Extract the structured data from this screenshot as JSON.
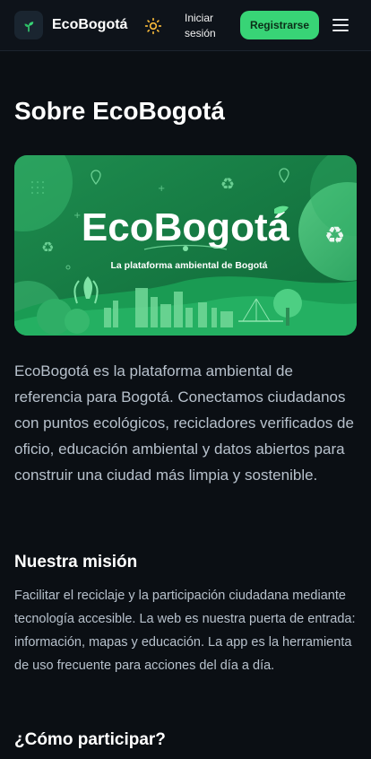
{
  "nav": {
    "brand": "EcoBogotá",
    "login_label": "Iniciar sesión",
    "register_label": "Registrarse",
    "logo_icon": "sprout-icon",
    "theme_icon": "sun-icon",
    "menu_icon": "hamburger-icon"
  },
  "page": {
    "title": "Sobre EcoBogotá"
  },
  "hero": {
    "heading": "EcoBogotá",
    "tagline": "La plataforma ambiental de Bogotá"
  },
  "intro": "EcoBogotá es la plataforma ambiental de referencia para Bogotá. Conectamos ciudadanos con puntos ecológicos, recicladores verificados de oficio, educación ambiental y datos abiertos para construir una ciudad más limpia y sostenible.",
  "mission": {
    "heading": "Nuestra misión",
    "body": "Facilitar el reciclaje y la participación ciudadana mediante tecnología accesible. La web es nuestra puerta de entrada: información, mapas y educación. La app es la herramienta de uso frecuente para acciones del día a día."
  },
  "participate": {
    "heading": "¿Cómo participar?"
  },
  "colors": {
    "accent": "#38d476",
    "background": "#0b0f14",
    "hero_green": "#1f8a4f"
  }
}
